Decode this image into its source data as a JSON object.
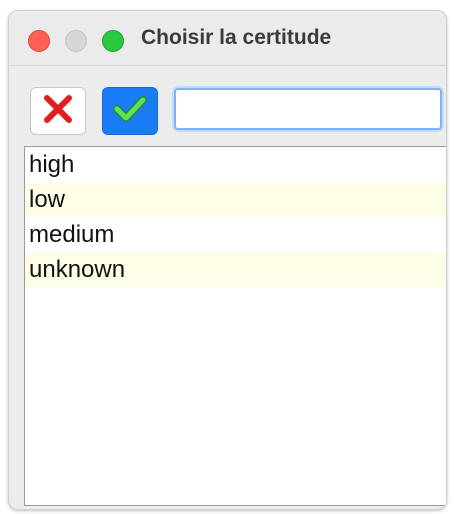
{
  "window": {
    "title": "Choisir la certitude"
  },
  "toolbar": {
    "cancel_icon": "red-x-icon",
    "confirm_icon": "green-check-icon",
    "filter_value": "",
    "filter_placeholder": ""
  },
  "colors": {
    "cancel_x": "#e02020",
    "confirm_bg": "#1a7cf5",
    "check": "#3cc43c",
    "alt_row": "#fefde8",
    "focus_ring": "#7fb3f5"
  },
  "list": {
    "items": [
      {
        "label": "high"
      },
      {
        "label": "low"
      },
      {
        "label": "medium"
      },
      {
        "label": "unknown"
      }
    ]
  }
}
